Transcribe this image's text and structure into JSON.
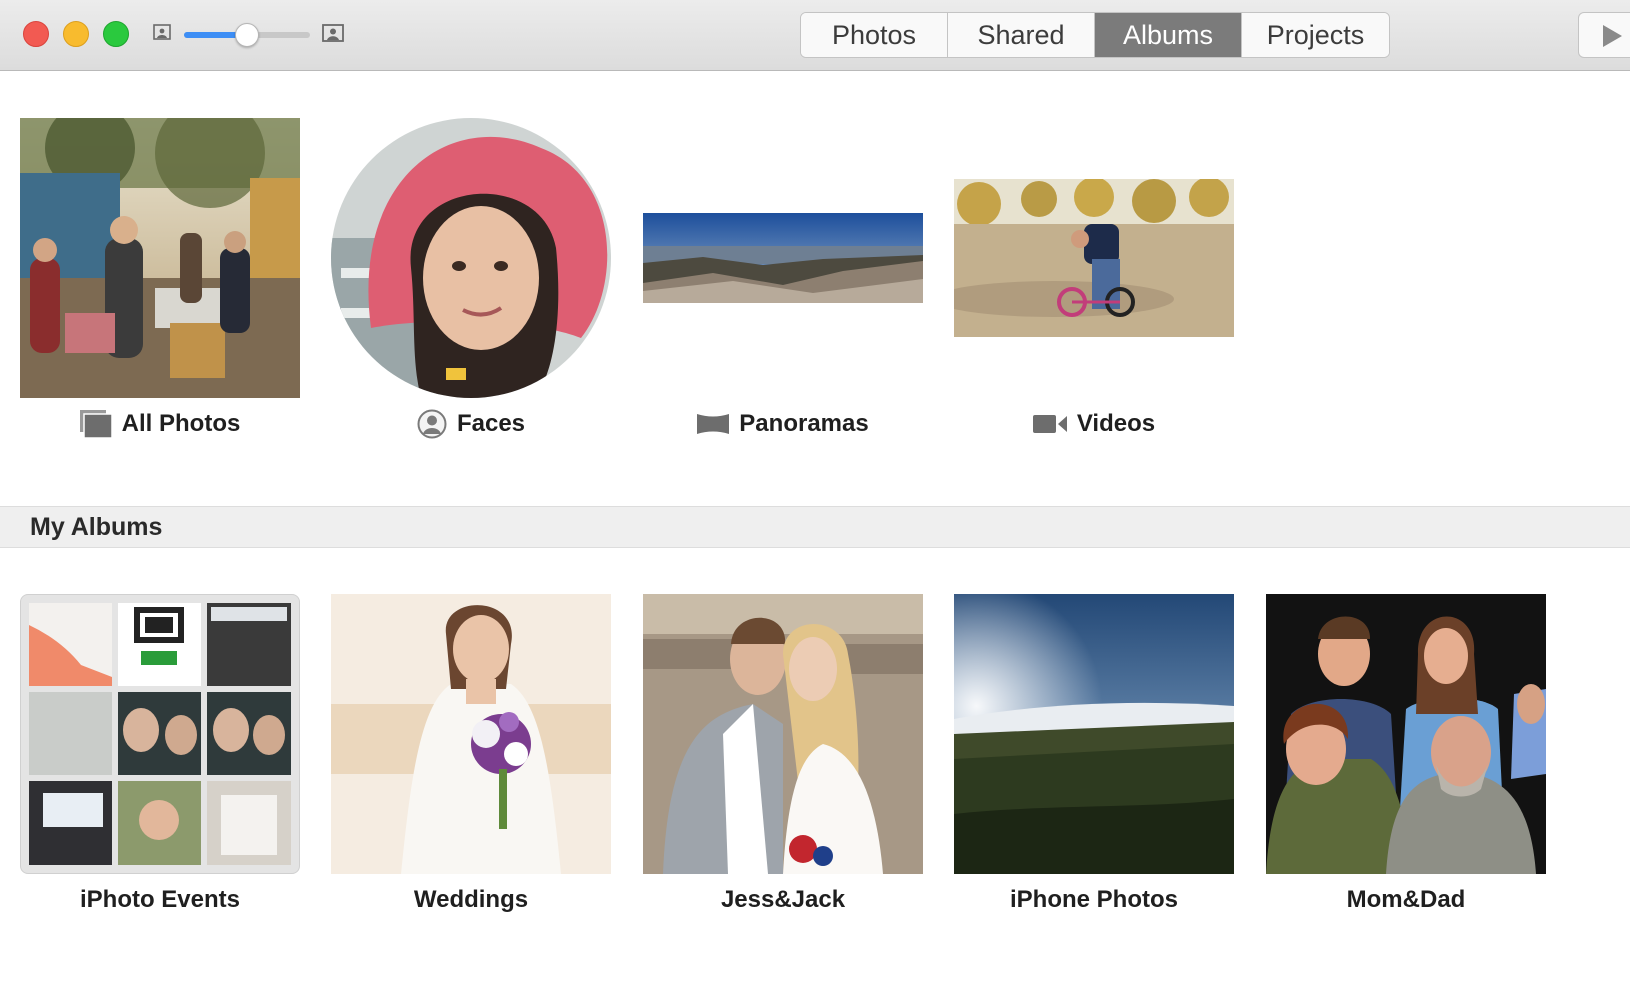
{
  "toolbar": {
    "tabs": [
      {
        "label": "Photos",
        "active": false
      },
      {
        "label": "Shared",
        "active": false
      },
      {
        "label": "Albums",
        "active": true
      },
      {
        "label": "Projects",
        "active": false
      }
    ],
    "zoom_level": 0.5
  },
  "colors": {
    "accent": "#3d8ef5",
    "close": "#f25a52",
    "minimize": "#f8bb2e",
    "maximize": "#2ac93e",
    "active_tab": "#7b7b7b"
  },
  "smart_albums": [
    {
      "label": "All Photos",
      "icon": "photo-stack-icon"
    },
    {
      "label": "Faces",
      "icon": "person-circle-icon"
    },
    {
      "label": "Panoramas",
      "icon": "panorama-icon"
    },
    {
      "label": "Videos",
      "icon": "video-camera-icon"
    }
  ],
  "my_albums": {
    "title": "My Albums",
    "items": [
      {
        "label": "iPhoto Events"
      },
      {
        "label": "Weddings"
      },
      {
        "label": "Jess&Jack"
      },
      {
        "label": "iPhone Photos"
      },
      {
        "label": "Mom&Dad"
      }
    ]
  }
}
